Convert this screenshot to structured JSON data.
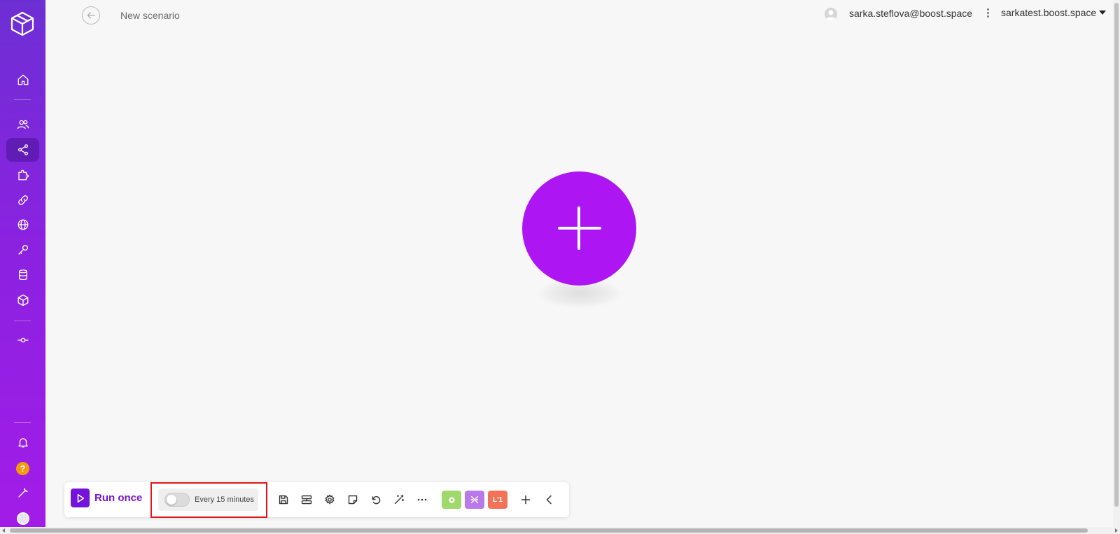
{
  "header": {
    "title": "New scenario",
    "user_email": "sarka.steflova@boost.space",
    "org_name": "sarkatest.boost.space"
  },
  "sidebar": {
    "items": [
      {
        "name": "home",
        "icon": "home-icon"
      },
      {
        "name": "team",
        "icon": "users-icon"
      },
      {
        "name": "scenarios",
        "icon": "share-icon",
        "active": true
      },
      {
        "name": "apps",
        "icon": "puzzle-icon"
      },
      {
        "name": "connections",
        "icon": "link-icon"
      },
      {
        "name": "webhooks",
        "icon": "globe-icon"
      },
      {
        "name": "keys",
        "icon": "key-icon"
      },
      {
        "name": "data-stores",
        "icon": "database-icon"
      },
      {
        "name": "data-structures",
        "icon": "cube-icon"
      },
      {
        "name": "devices",
        "icon": "commit-icon"
      },
      {
        "name": "notifications",
        "icon": "bell-icon"
      },
      {
        "name": "help",
        "icon": "help-icon",
        "text": "?"
      },
      {
        "name": "settings",
        "icon": "wrench-icon"
      },
      {
        "name": "profile",
        "icon": "avatar"
      }
    ]
  },
  "toolbar": {
    "run_label": "Run once",
    "schedule_label": "Every 15 minutes",
    "schedule_enabled": false,
    "tools": [
      "save-icon",
      "auto-align-icon",
      "settings-icon",
      "notes-icon",
      "undo-icon",
      "magic-wand-icon",
      "more-icon"
    ],
    "color_buttons": [
      {
        "name": "tools",
        "color": "#9fd86b"
      },
      {
        "name": "flow-control",
        "color": "#b77ae8"
      },
      {
        "name": "text-parser",
        "color": "#f27258",
        "text": "L'1"
      }
    ],
    "add_label": "+",
    "collapse_icon": "chevron-left-icon"
  },
  "colors": {
    "brand": "#ad16f2",
    "run": "#7514d9",
    "highlight": "#e1141b"
  }
}
